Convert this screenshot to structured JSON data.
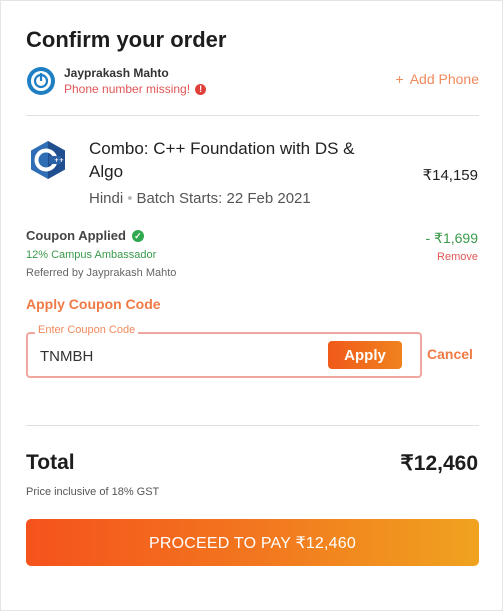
{
  "title": "Confirm your order",
  "user": {
    "name": "Jayprakash Mahto",
    "warning": "Phone number missing!",
    "add_phone": "Add Phone"
  },
  "course": {
    "title": "Combo: C++ Foundation with DS & Algo",
    "language": "Hindi",
    "batch": "Batch Starts: 22 Feb 2021",
    "price": "₹14,159"
  },
  "coupon": {
    "applied_label": "Coupon Applied",
    "description": "12% Campus Ambassador",
    "referred": "Referred by Jayprakash Mahto",
    "discount": "- ₹1,699",
    "remove": "Remove",
    "apply_code_label": "Apply Coupon Code",
    "input_legend": "Enter Coupon Code",
    "input_value": "TNMBH",
    "apply_button": "Apply",
    "cancel": "Cancel"
  },
  "total": {
    "label": "Total",
    "value": "₹12,460",
    "gst_note": "Price inclusive of 18% GST"
  },
  "pay_button": "PROCEED TO PAY ₹12,460",
  "colors": {
    "accent": "#f07a45",
    "success": "#3a9a4a",
    "error": "#e05555"
  }
}
